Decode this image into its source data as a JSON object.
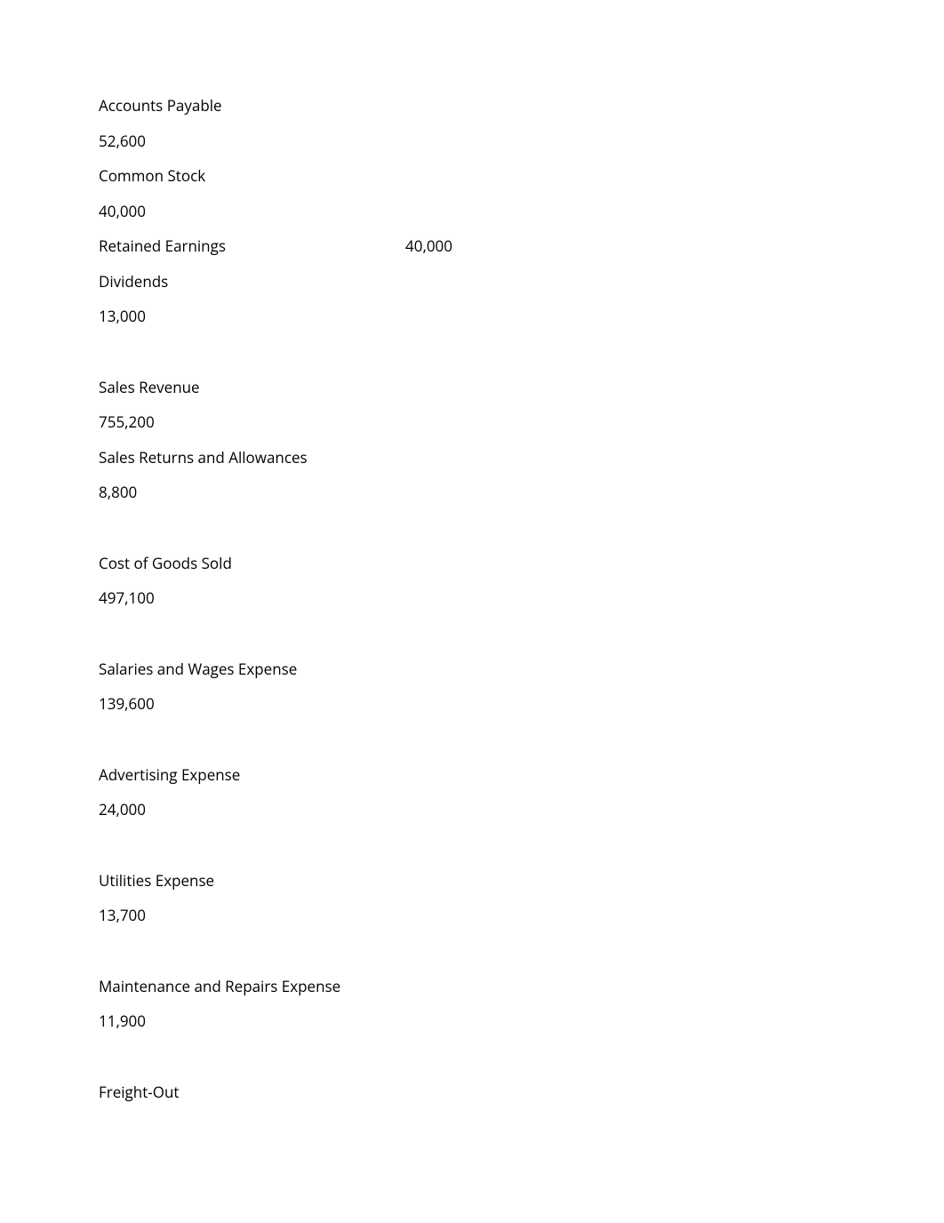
{
  "lines": [
    {
      "label": "Accounts Payable",
      "value": ""
    },
    {
      "label": "52,600",
      "value": ""
    },
    {
      "label": "Common Stock",
      "value": ""
    },
    {
      "label": "40,000",
      "value": ""
    },
    {
      "label": "Retained Earnings",
      "value": "40,000"
    },
    {
      "label": "Dividends",
      "value": ""
    },
    {
      "label": "13,000",
      "value": ""
    }
  ],
  "groups": [
    [
      {
        "label": "Sales Revenue",
        "value": ""
      },
      {
        "label": "755,200",
        "value": ""
      },
      {
        "label": "Sales Returns and Allowances",
        "value": ""
      },
      {
        "label": "8,800",
        "value": ""
      }
    ],
    [
      {
        "label": "Cost of Goods Sold",
        "value": ""
      },
      {
        "label": "497,100",
        "value": ""
      }
    ],
    [
      {
        "label": "Salaries and Wages Expense",
        "value": ""
      },
      {
        "label": "139,600",
        "value": ""
      }
    ],
    [
      {
        "label": "Advertising Expense",
        "value": ""
      },
      {
        "label": "24,000",
        "value": ""
      }
    ],
    [
      {
        "label": "Utilities Expense",
        "value": ""
      },
      {
        "label": "13,700",
        "value": ""
      }
    ],
    [
      {
        "label": "Maintenance and Repairs Expense",
        "value": ""
      },
      {
        "label": "11,900",
        "value": ""
      }
    ],
    [
      {
        "label": "Freight-Out",
        "value": ""
      }
    ]
  ]
}
